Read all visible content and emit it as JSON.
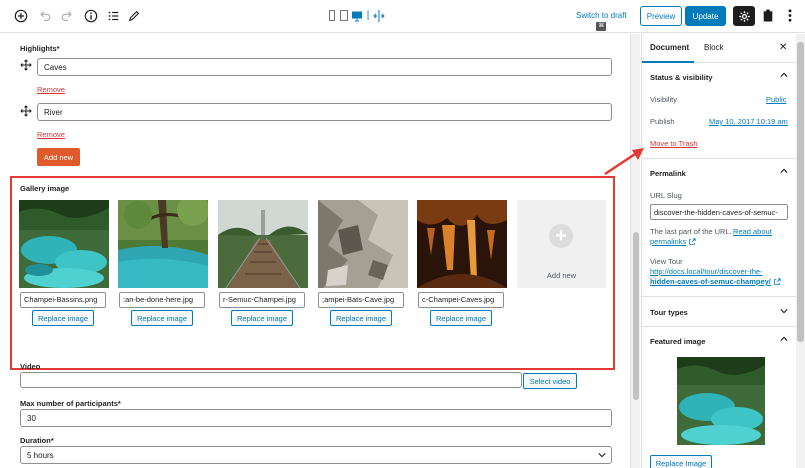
{
  "toolbar": {
    "switch_draft": "Switch to draft",
    "switch_kbd": "⌘",
    "preview": "Preview",
    "update": "Update"
  },
  "editor": {
    "highlights_label": "Highlights*",
    "highlights": [
      {
        "value": "Caves",
        "remove": "Remove"
      },
      {
        "value": "River",
        "remove": "Remove"
      }
    ],
    "add_new": "Add new",
    "gallery_label": "Gallery image",
    "gallery": [
      {
        "file": "Champei-Bassins.png",
        "button": "Replace image"
      },
      {
        "file": ":an-be-done-here.jpg",
        "button": "Replace image"
      },
      {
        "file": "r-Semuc-Champei.jpg",
        "button": "Replace image"
      },
      {
        "file": ";ampei-Bats-Cave.jpg",
        "button": "Replace image"
      },
      {
        "file": "c-Champei-Caves.jpg",
        "button": "Replace image"
      }
    ],
    "gallery_add": "Add new",
    "video_label": "Video",
    "video_value": "",
    "select_video": "Select video",
    "participants_label": "Max number of participants*",
    "participants_value": "30",
    "duration_label": "Duration*",
    "duration_value": "5 hours"
  },
  "sidebar": {
    "tab_document": "Document",
    "tab_block": "Block",
    "status_title": "Status & visibility",
    "visibility_label": "Visibility",
    "visibility_value": "Public",
    "publish_label": "Publish",
    "publish_value": "May 10, 2017 10:19 am",
    "trash": "Move to Trash",
    "permalink_title": "Permalink",
    "slug_label": "URL Slug",
    "slug_value": "discover-the-hidden-caves-of-semuc-",
    "slug_help": "The last part of the URL.",
    "read_about": "Read about",
    "permalinks": "permalinks",
    "view_tour": "View Tour",
    "tour_url_1": "http://docs.local/tour/discover-the-",
    "tour_url_2": "hidden-caves-of-semuc-champey/",
    "tour_types_title": "Tour types",
    "featured_title": "Featured image",
    "replace_image": "Replace Image"
  },
  "colors": {
    "accent": "#007cba",
    "danger": "#d63638",
    "add_button": "#e05a2b",
    "highlight_box": "#e53935"
  }
}
